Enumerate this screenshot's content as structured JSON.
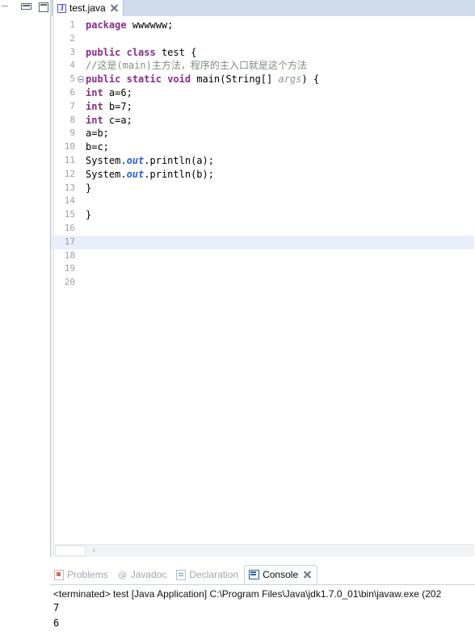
{
  "viewbar": {
    "minimize_icon": "minimize-icon",
    "maximize_icon": "maximize-icon",
    "restore_icon": "restore-icon"
  },
  "editor": {
    "tab": {
      "label": "test.java",
      "icon": "java-file-icon",
      "close_icon": "close-icon",
      "active": true
    },
    "current_line": 17,
    "total_visible_lines": 20,
    "highlight_color": "#e8eefa",
    "tabfolder_color": "#cedcec",
    "colors": {
      "keyword": "#8a2b8a",
      "comment": "#7f8b7f",
      "static_field": "#2f5fd0",
      "parameter": "#8f949b",
      "text": "#000000",
      "line_number": "#9aa0a8"
    },
    "lines": [
      {
        "n": "1",
        "fold": false,
        "tokens": [
          {
            "t": "package",
            "c": "kw"
          },
          {
            "t": " ",
            "c": "plain"
          },
          {
            "t": "wwwwww;",
            "c": "plain"
          }
        ]
      },
      {
        "n": "2",
        "fold": false,
        "tokens": []
      },
      {
        "n": "3",
        "fold": false,
        "tokens": [
          {
            "t": "public",
            "c": "kw"
          },
          {
            "t": " ",
            "c": "plain"
          },
          {
            "t": "class",
            "c": "kw"
          },
          {
            "t": " test {",
            "c": "plain"
          }
        ]
      },
      {
        "n": "4",
        "fold": false,
        "tokens": [
          {
            "t": "//这是",
            "c": "cmt"
          },
          {
            "t": "(main)",
            "c": "cmt-m"
          },
          {
            "t": "主方法，程序的主入口就是这个方法",
            "c": "cmt"
          }
        ]
      },
      {
        "n": "5",
        "fold": true,
        "tokens": [
          {
            "t": "public",
            "c": "kw"
          },
          {
            "t": " ",
            "c": "plain"
          },
          {
            "t": "static",
            "c": "kw"
          },
          {
            "t": " ",
            "c": "plain"
          },
          {
            "t": "void",
            "c": "kw"
          },
          {
            "t": " main(String[] ",
            "c": "plain"
          },
          {
            "t": "args",
            "c": "prm"
          },
          {
            "t": ") {",
            "c": "plain"
          }
        ]
      },
      {
        "n": "6",
        "fold": false,
        "tokens": [
          {
            "t": "int",
            "c": "kw"
          },
          {
            "t": " a=6;",
            "c": "plain"
          }
        ]
      },
      {
        "n": "7",
        "fold": false,
        "tokens": [
          {
            "t": "int",
            "c": "kw"
          },
          {
            "t": " b=7;",
            "c": "plain"
          }
        ]
      },
      {
        "n": "8",
        "fold": false,
        "tokens": [
          {
            "t": "int",
            "c": "kw"
          },
          {
            "t": " c=a;",
            "c": "plain"
          }
        ]
      },
      {
        "n": "9",
        "fold": false,
        "tokens": [
          {
            "t": "a=b;",
            "c": "plain"
          }
        ]
      },
      {
        "n": "10",
        "fold": false,
        "tokens": [
          {
            "t": "b=c;",
            "c": "plain"
          }
        ]
      },
      {
        "n": "11",
        "fold": false,
        "tokens": [
          {
            "t": "System.",
            "c": "plain"
          },
          {
            "t": "out",
            "c": "fld"
          },
          {
            "t": ".println(a);",
            "c": "plain"
          }
        ]
      },
      {
        "n": "12",
        "fold": false,
        "tokens": [
          {
            "t": "System.",
            "c": "plain"
          },
          {
            "t": "out",
            "c": "fld"
          },
          {
            "t": ".println(b);",
            "c": "plain"
          }
        ]
      },
      {
        "n": "13",
        "fold": false,
        "tokens": [
          {
            "t": "}",
            "c": "plain"
          }
        ]
      },
      {
        "n": "14",
        "fold": false,
        "tokens": []
      },
      {
        "n": "15",
        "fold": false,
        "tokens": [
          {
            "t": "}",
            "c": "plain"
          }
        ]
      },
      {
        "n": "16",
        "fold": false,
        "tokens": []
      },
      {
        "n": "17",
        "fold": false,
        "tokens": []
      },
      {
        "n": "18",
        "fold": false,
        "tokens": []
      },
      {
        "n": "19",
        "fold": false,
        "tokens": []
      },
      {
        "n": "20",
        "fold": false,
        "tokens": []
      }
    ],
    "hscroll": {
      "arrow_icon": "chevron-left-icon",
      "arrow_glyph": "‹"
    }
  },
  "bottom_stack": {
    "tabs": [
      {
        "label": "Problems",
        "icon": "problems-icon",
        "active": false,
        "closable": false
      },
      {
        "label": "Javadoc",
        "icon": "javadoc-icon",
        "active": false,
        "closable": false,
        "glyph": "@"
      },
      {
        "label": "Declaration",
        "icon": "declaration-icon",
        "active": false,
        "closable": false
      },
      {
        "label": "Console",
        "icon": "console-icon",
        "active": true,
        "closable": true
      }
    ],
    "console": {
      "status_line": "<terminated> test [Java Application] C:\\Program Files\\Java\\jdk1.7.0_01\\bin\\javaw.exe (202",
      "output": [
        "7",
        "6"
      ]
    }
  }
}
